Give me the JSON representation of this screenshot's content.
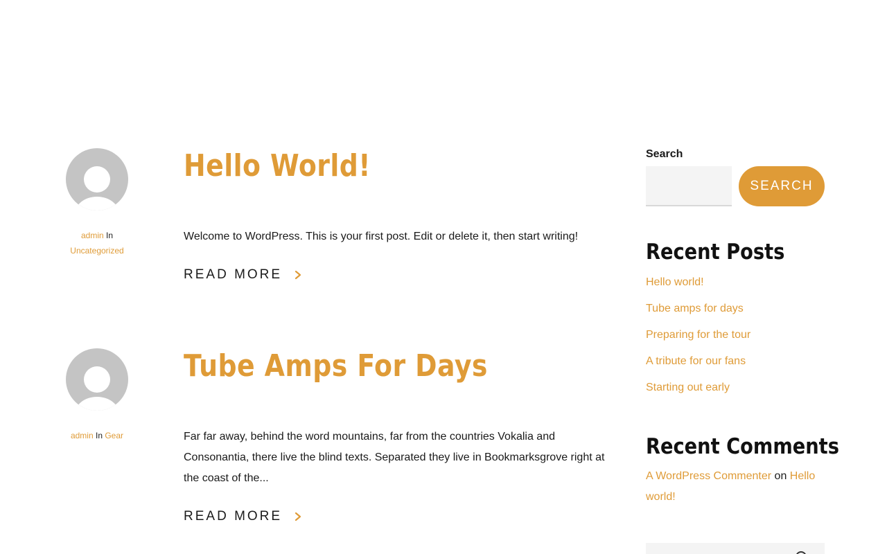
{
  "posts": [
    {
      "title": "Hello World!",
      "author": "admin",
      "in_word": "In",
      "category": "Uncategorized",
      "excerpt": "Welcome to WordPress. This is your first post. Edit or delete it, then start writing!",
      "read_more": "READ MORE"
    },
    {
      "title": "Tube Amps For Days",
      "author": "admin",
      "in_word": "In",
      "category": "Gear",
      "excerpt": "Far far away, behind the word mountains, far from the countries Vokalia and Consonantia, there live the blind texts. Separated they live in Bookmarksgrove right at the coast of the...",
      "read_more": "READ MORE"
    }
  ],
  "sidebar": {
    "search_label": "Search",
    "search_value": "",
    "search_button": "SEARCH",
    "recent_posts_title": "Recent Posts",
    "recent_posts": [
      "Hello world!",
      "Tube amps for days",
      "Preparing for the tour",
      "A tribute for our fans",
      "Starting out early"
    ],
    "recent_comments_title": "Recent Comments",
    "comment": {
      "author": "A WordPress Commenter",
      "on_word": "on",
      "post": "Hello world!"
    }
  },
  "icons": {
    "avatar": "avatar-placeholder-icon",
    "read_more": "chevron-right-icon"
  },
  "colors": {
    "accent": "#df9b37",
    "text": "#1a1a1a",
    "avatar_bg": "#c4c4c4",
    "input_bg": "#f4f4f4"
  }
}
